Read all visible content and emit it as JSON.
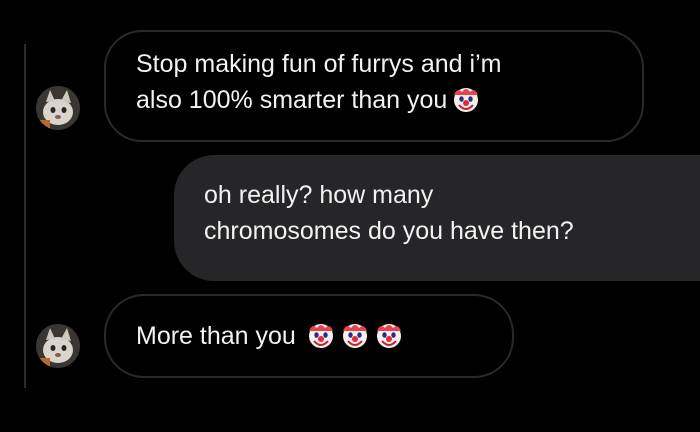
{
  "conversation": {
    "messages": [
      {
        "sender": "other",
        "lines": [
          "Stop making fun of furrys and i’m",
          "also 100% smarter than you"
        ],
        "trailing_emojis": [
          "clown-face"
        ]
      },
      {
        "sender": "self",
        "lines": [
          "oh really? how many",
          "chromosomes do you have then?"
        ],
        "trailing_emojis": []
      },
      {
        "sender": "other",
        "lines": [
          "More than you"
        ],
        "trailing_emojis": [
          "clown-face",
          "clown-face",
          "clown-face"
        ]
      }
    ]
  },
  "theme": {
    "background": "#000000",
    "incoming_bubble_border": "#2a2a2c",
    "outgoing_bubble_fill": "#262628",
    "text_color": "#f2f2f2"
  }
}
